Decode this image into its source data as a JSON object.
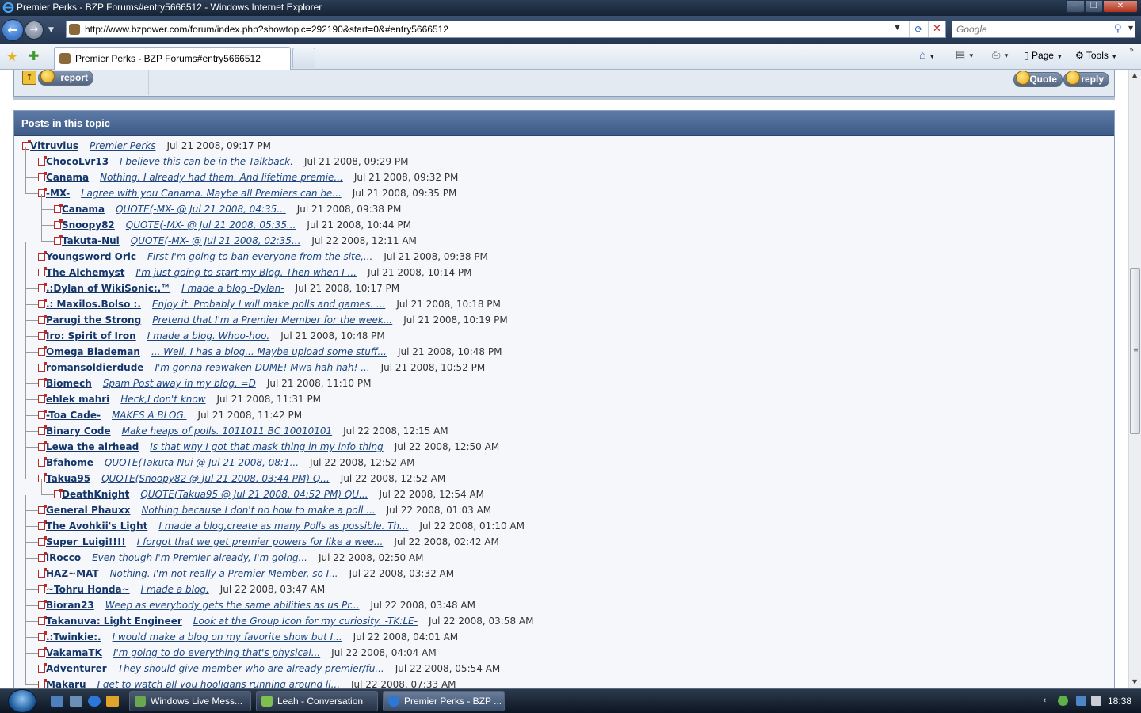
{
  "window": {
    "title": "Premier Perks - BZP Forums#entry5666512 - Windows Internet Explorer",
    "minimize_glyph": "—",
    "maximize_glyph": "❐",
    "close_glyph": "✕"
  },
  "addressbar": {
    "url": "http://www.bzpower.com/forum/index.php?showtopic=292190&start=0&#entry5666512",
    "search_placeholder": "Google"
  },
  "tabs": [
    {
      "label": "Premier Perks - BZP Forums#entry5666512",
      "active": true
    }
  ],
  "commandbar": {
    "page_label": "Page",
    "tools_label": "Tools"
  },
  "post_buttons": {
    "report": "report",
    "quote": "Quote",
    "reply": "reply"
  },
  "topic_panel": {
    "title": "Posts in this topic",
    "posts": [
      {
        "level": 0,
        "author": "Vitruvius",
        "title": "Premier Perks",
        "date": "Jul 21 2008, 09:17 PM"
      },
      {
        "level": 1,
        "author": "ChocoLvr13",
        "title": "I believe this can be in the Talkback.",
        "date": "Jul 21 2008, 09:29 PM"
      },
      {
        "level": 1,
        "author": "Canama",
        "title": "Nothing. I already had them. And lifetime premie...",
        "date": "Jul 21 2008, 09:32 PM"
      },
      {
        "level": 1,
        "author": "-MX-",
        "title": "I agree with you Canama. Maybe all Premiers can be...",
        "date": "Jul 21 2008, 09:35 PM"
      },
      {
        "level": 2,
        "author": "Canama",
        "title": "QUOTE(-MX- @ Jul 21 2008, 04:35...",
        "date": "Jul 21 2008, 09:38 PM"
      },
      {
        "level": 2,
        "author": "Snoopy82",
        "title": "QUOTE(-MX- @ Jul 21 2008, 05:35...",
        "date": "Jul 21 2008, 10:44 PM"
      },
      {
        "level": 2,
        "author": "Takuta-Nui",
        "title": "QUOTE(-MX- @ Jul 21 2008, 02:35...",
        "date": "Jul 22 2008, 12:11 AM"
      },
      {
        "level": 1,
        "author": "Youngsword Oric",
        "title": "First I'm going to ban everyone from the site,...",
        "date": "Jul 21 2008, 09:38 PM"
      },
      {
        "level": 1,
        "author": "The Alchemyst",
        "title": "I'm just going to start my Blog. Then when I ...",
        "date": "Jul 21 2008, 10:14 PM"
      },
      {
        "level": 1,
        "author": ".:Dylan of WikiSonic:.™",
        "title": "I made a blog -Dylan-",
        "date": "Jul 21 2008, 10:17 PM"
      },
      {
        "level": 1,
        "author": ".: Maxilos.Bolso :.",
        "title": "Enjoy it. Probably I will make polls and games. ...",
        "date": "Jul 21 2008, 10:18 PM"
      },
      {
        "level": 1,
        "author": "Parugi the Strong",
        "title": "Pretend that I'm a Premier Member for the week...",
        "date": "Jul 21 2008, 10:19 PM"
      },
      {
        "level": 1,
        "author": "Iro: Spirit of Iron",
        "title": "I made a blog. Whoo-hoo.",
        "date": "Jul 21 2008, 10:48 PM"
      },
      {
        "level": 1,
        "author": "Omega Blademan",
        "title": "... Well, I has a blog... Maybe upload some stuff...",
        "date": "Jul 21 2008, 10:48 PM"
      },
      {
        "level": 1,
        "author": "romansoldierdude",
        "title": "I'm gonna reawaken DUME! Mwa hah hah! ...",
        "date": "Jul 21 2008, 10:52 PM"
      },
      {
        "level": 1,
        "author": "Biomech",
        "title": "Spam Post away in my blog. =D",
        "date": "Jul 21 2008, 11:10 PM"
      },
      {
        "level": 1,
        "author": "ehlek mahri",
        "title": "Heck,I don't know",
        "date": "Jul 21 2008, 11:31 PM"
      },
      {
        "level": 1,
        "author": "-Toa Cade-",
        "title": "MAKES A BLOG.",
        "date": "Jul 21 2008, 11:42 PM"
      },
      {
        "level": 1,
        "author": "Binary Code",
        "title": "Make heaps of polls. 1011011 BC 10010101",
        "date": "Jul 22 2008, 12:15 AM"
      },
      {
        "level": 1,
        "author": "Lewa the airhead",
        "title": "Is that why I got that mask thing in my info thing",
        "date": "Jul 22 2008, 12:50 AM"
      },
      {
        "level": 1,
        "author": "Bfahome",
        "title": "QUOTE(Takuta-Nui @ Jul 21 2008, 08:1...",
        "date": "Jul 22 2008, 12:52 AM"
      },
      {
        "level": 1,
        "author": "Takua95",
        "title": "QUOTE(Snoopy82 @ Jul 21 2008, 03:44 PM) Q...",
        "date": "Jul 22 2008, 12:52 AM"
      },
      {
        "level": 2,
        "author": "DeathKnight",
        "title": "QUOTE(Takua95 @ Jul 21 2008, 04:52 PM) QU...",
        "date": "Jul 22 2008, 12:54 AM"
      },
      {
        "level": 1,
        "author": "General Phauxx",
        "title": "Nothing because I don't no how to make a poll ...",
        "date": "Jul 22 2008, 01:03 AM"
      },
      {
        "level": 1,
        "author": "The Avohkii's Light",
        "title": "I made a blog,create as many Polls as possible. Th...",
        "date": "Jul 22 2008, 01:10 AM"
      },
      {
        "level": 1,
        "author": "Super_Luigi!!!!",
        "title": "I forgot that we get premier powers for like a wee...",
        "date": "Jul 22 2008, 02:42 AM"
      },
      {
        "level": 1,
        "author": "iRocco",
        "title": "Even though I'm Premier already, I'm going...",
        "date": "Jul 22 2008, 02:50 AM"
      },
      {
        "level": 1,
        "author": "HAZ~MAT",
        "title": "Nothing. I'm not really a Premier Member, so I...",
        "date": "Jul 22 2008, 03:32 AM"
      },
      {
        "level": 1,
        "author": "~Tohru Honda~",
        "title": "I made a blog.",
        "date": "Jul 22 2008, 03:47 AM"
      },
      {
        "level": 1,
        "author": "Bioran23",
        "title": "Weep as everybody gets the same abilities as us Pr...",
        "date": "Jul 22 2008, 03:48 AM"
      },
      {
        "level": 1,
        "author": "Takanuva: Light Engineer",
        "title": "Look at the Group Icon for my curiosity. -TK:LE-",
        "date": "Jul 22 2008, 03:58 AM"
      },
      {
        "level": 1,
        "author": ".:Twinkie:.",
        "title": "I would make a blog on my favorite show but I...",
        "date": "Jul 22 2008, 04:01 AM"
      },
      {
        "level": 1,
        "author": "VakamaTK",
        "title": "I'm going to do everything that's physical...",
        "date": "Jul 22 2008, 04:04 AM"
      },
      {
        "level": 1,
        "author": "Adventurer",
        "title": "They should give member who are already premier/fu...",
        "date": "Jul 22 2008, 05:54 AM"
      },
      {
        "level": 1,
        "author": "Makaru",
        "title": "I get to watch all you hooligans running around li...",
        "date": "Jul 22 2008, 07:33 AM"
      }
    ]
  },
  "taskbar": {
    "items": [
      {
        "label": "Windows Live Mess...",
        "icon": "messenger-icon",
        "color": "#6aa84f"
      },
      {
        "label": "Leah - Conversation",
        "icon": "contact-icon",
        "color": "#7fbf4f"
      },
      {
        "label": "Premier Perks - BZP ...",
        "icon": "ie-icon",
        "color": "#2b78d8"
      }
    ],
    "clock": "18:38"
  },
  "colors": {
    "panel_header": "#3d5a88",
    "author_link": "#14356a",
    "node_marker": "#bb2a2a"
  }
}
